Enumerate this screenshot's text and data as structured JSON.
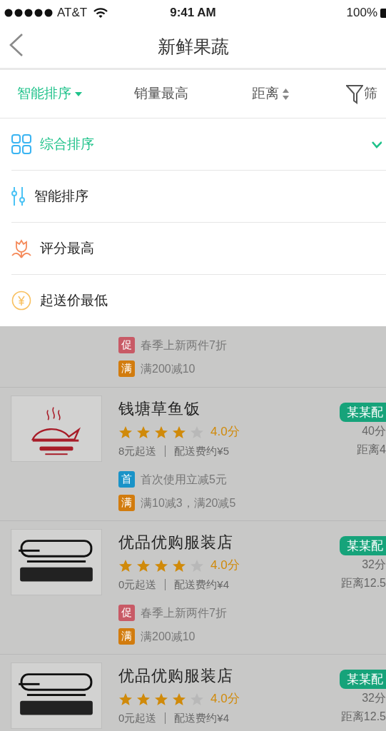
{
  "status_bar": {
    "carrier": "AT&T",
    "time": "9:41 AM",
    "battery": "100%"
  },
  "nav": {
    "title": "新鲜果蔬"
  },
  "filter_tabs": [
    {
      "label": "智能排序",
      "kind": "dropdown",
      "selected": true
    },
    {
      "label": "销量最高",
      "kind": "plain",
      "selected": false
    },
    {
      "label": "距离",
      "kind": "sort",
      "selected": false
    },
    {
      "label": "筛",
      "kind": "filter",
      "selected": false
    }
  ],
  "sort_menu": {
    "open": true,
    "options": [
      {
        "label": "综合排序",
        "kind": "grid",
        "selected": true
      },
      {
        "label": "智能排序",
        "kind": "sliders",
        "selected": false
      },
      {
        "label": "评分最高",
        "kind": "flower",
        "selected": false
      },
      {
        "label": "起送价最低",
        "kind": "yen",
        "selected": false
      }
    ]
  },
  "stores": [
    {
      "promos": [
        {
          "badge": "促",
          "text": "春季上新两件7折",
          "color": "#c85a66"
        },
        {
          "badge": "满",
          "text": "满200减10",
          "color": "#d27c0e"
        }
      ]
    },
    {
      "name": "钱塘草鱼饭",
      "stars": 4,
      "rating": "4.0分",
      "min_order": "8元起送",
      "delivery_fee": "配送费约¥5",
      "tag": "某某配",
      "time": "40分",
      "distance": "距离4",
      "promos": [
        {
          "badge": "首",
          "text": "首次使用立减5元",
          "color": "#1a93c8"
        },
        {
          "badge": "满",
          "text": "满10减3，满20减5",
          "color": "#d27c0e"
        }
      ]
    },
    {
      "name": "优品优购服装店",
      "stars": 4,
      "rating": "4.0分",
      "min_order": "0元起送",
      "delivery_fee": "配送费约¥4",
      "tag": "某某配",
      "time": "32分",
      "distance": "距离12.5",
      "promos": [
        {
          "badge": "促",
          "text": "春季上新两件7折",
          "color": "#c85a66"
        },
        {
          "badge": "满",
          "text": "满200减10",
          "color": "#d27c0e"
        }
      ]
    },
    {
      "name": "优品优购服装店",
      "stars": 4,
      "rating": "4.0分",
      "min_order": "0元起送",
      "delivery_fee": "配送费约¥4",
      "tag": "某某配",
      "time": "32分",
      "distance": "距离12.5"
    }
  ]
}
